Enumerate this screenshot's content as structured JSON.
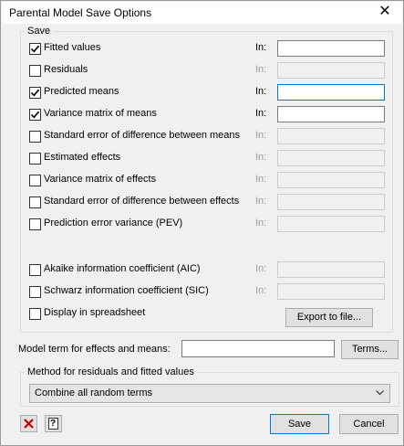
{
  "window": {
    "title": "Parental Model Save Options",
    "close_glyph": "✕"
  },
  "save_group": {
    "label": "Save",
    "in_label": "In:",
    "options": [
      {
        "label": "Fitted values",
        "checked": true,
        "enabled": true,
        "has_in": true,
        "focused": false
      },
      {
        "label": "Residuals",
        "checked": false,
        "enabled": false,
        "has_in": true,
        "focused": false
      },
      {
        "label": "Predicted means",
        "checked": true,
        "enabled": true,
        "has_in": true,
        "focused": true
      },
      {
        "label": "Variance matrix of means",
        "checked": true,
        "enabled": true,
        "has_in": true,
        "focused": false
      },
      {
        "label": "Standard error of difference between means",
        "checked": false,
        "enabled": false,
        "has_in": true,
        "focused": false
      },
      {
        "label": "Estimated effects",
        "checked": false,
        "enabled": false,
        "has_in": true,
        "focused": false
      },
      {
        "label": "Variance matrix of effects",
        "checked": false,
        "enabled": false,
        "has_in": true,
        "focused": false
      },
      {
        "label": "Standard error of difference between effects",
        "checked": false,
        "enabled": false,
        "has_in": true,
        "focused": false
      },
      {
        "label": "Prediction error variance (PEV)",
        "checked": false,
        "enabled": false,
        "has_in": true,
        "focused": false
      },
      {
        "label": "Akaike information coefficient (AIC)",
        "checked": false,
        "enabled": false,
        "has_in": true,
        "focused": false
      },
      {
        "label": "Schwarz information coefficient (SIC)",
        "checked": false,
        "enabled": false,
        "has_in": true,
        "focused": false
      }
    ],
    "display_in_spreadsheet": {
      "label": "Display in spreadsheet",
      "checked": false
    },
    "export_button": "Export to file..."
  },
  "model_term": {
    "label": "Model term for effects and means:",
    "value": "",
    "terms_button": "Terms..."
  },
  "method_group": {
    "label": "Method for residuals and fitted values",
    "selected": "Combine all random terms"
  },
  "footer": {
    "clear_icon": "red-x-icon",
    "help_icon": "help-icon",
    "help_glyph": "?",
    "save_button": "Save",
    "cancel_button": "Cancel"
  },
  "colors": {
    "accent": "#0078d7",
    "clear_red": "#c00000"
  }
}
